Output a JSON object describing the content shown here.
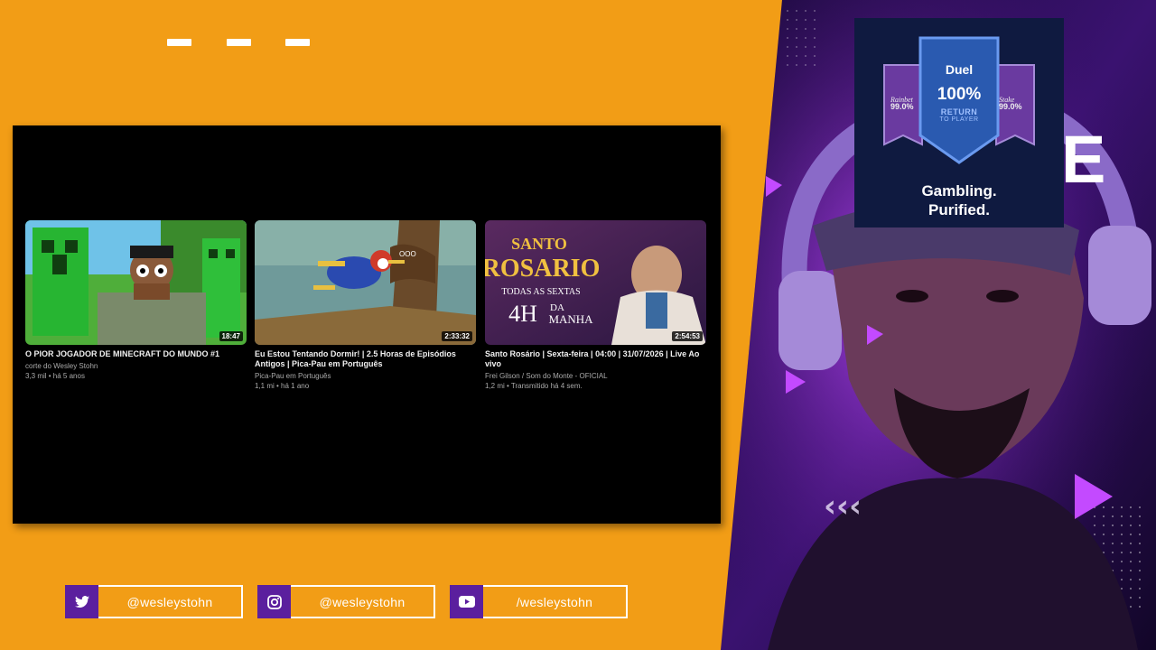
{
  "top_dashes": [
    "dash",
    "dash",
    "dash"
  ],
  "videos": [
    {
      "title": "O PIOR JOGADOR DE MINECRAFT DO MUNDO #1",
      "channel": "corte do Wesley Stohn",
      "meta": "3,3 mil • há 5 anos",
      "duration": "18:47"
    },
    {
      "title": "Eu Estou Tentando Dormir! | 2.5 Horas de Episódios Antigos | Pica-Pau em Português",
      "channel": "Pica-Pau em Português",
      "meta": "1,1 mi • há 1 ano",
      "duration": "2:33:32"
    },
    {
      "title": "Santo Rosário | Sexta-feira | 04:00 | 31/07/2026 | Live Ao vivo",
      "channel": "Frei Gilson / Som do Monte - OFICIAL",
      "meta": "1,2 mi • Transmitido há 4 sem.",
      "duration": "2:54:53",
      "thumb_text": {
        "line1": "SANTO",
        "line2": "ROSARIO",
        "line3": "TODAS AS SEXTAS",
        "line4": "4H",
        "line5": "DA",
        "line6": "MANHA"
      }
    }
  ],
  "social": [
    {
      "icon": "twitter-icon",
      "handle": "@wesleystohn"
    },
    {
      "icon": "instagram-icon",
      "handle": "@wesleystohn"
    },
    {
      "icon": "youtube-icon",
      "handle": "/wesleystohn"
    }
  ],
  "ad": {
    "brand": "Duel",
    "percent": "100%",
    "return_label": "RETURN",
    "return_sub": "TO PLAYER",
    "left_brand": "Rainbet",
    "left_value": "99.0%",
    "right_brand": "Stake",
    "right_value": "99.0%",
    "tagline_1": "Gambling.",
    "tagline_2": "Purified."
  },
  "side_letter": "E",
  "colors": {
    "background": "#f29d16",
    "social_icon_bg": "#5b1f9e",
    "panel_purple": "#7a2bd8"
  }
}
